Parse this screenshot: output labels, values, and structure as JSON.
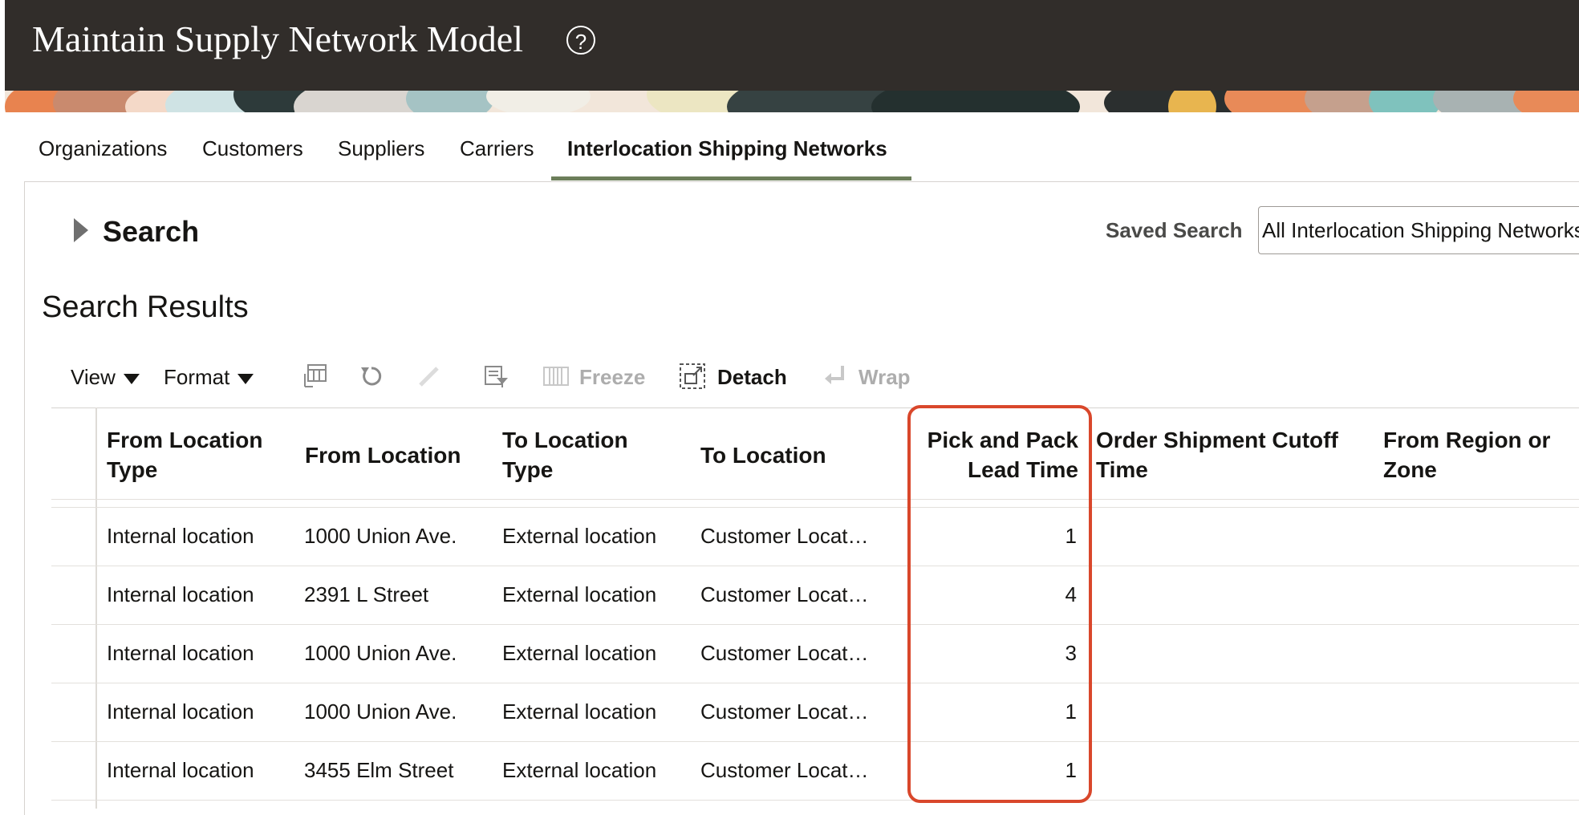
{
  "header": {
    "title": "Maintain Supply Network Model",
    "help_icon": "help-circle-icon"
  },
  "tabs": [
    {
      "label": "Organizations",
      "active": false
    },
    {
      "label": "Customers",
      "active": false
    },
    {
      "label": "Suppliers",
      "active": false
    },
    {
      "label": "Carriers",
      "active": false
    },
    {
      "label": "Interlocation Shipping Networks",
      "active": true
    }
  ],
  "search": {
    "title": "Search",
    "saved_search_label": "Saved Search",
    "saved_search_value": "All Interlocation Shipping Networks"
  },
  "results": {
    "title": "Search Results",
    "toolbar": {
      "view": "View",
      "format": "Format",
      "freeze": "Freeze",
      "detach": "Detach",
      "wrap": "Wrap"
    },
    "columns": {
      "from_type": [
        "From Location",
        "Type"
      ],
      "from_loc": "From Location",
      "to_type": [
        "To Location",
        "Type"
      ],
      "to_loc": "To Location",
      "pick_pack": [
        "Pick and Pack",
        "Lead Time"
      ],
      "cutoff": [
        "Order Shipment Cutoff",
        "Time"
      ],
      "region": [
        "From Region or",
        "Zone"
      ]
    },
    "rows": [
      {
        "from_type": "Internal location",
        "from_loc": "1000 Union Ave.",
        "to_type": "External location",
        "to_loc": "Customer Locat…",
        "pick_pack": "1"
      },
      {
        "from_type": "Internal location",
        "from_loc": "2391 L Street",
        "to_type": "External location",
        "to_loc": "Customer Locat…",
        "pick_pack": "4"
      },
      {
        "from_type": "Internal location",
        "from_loc": "1000 Union Ave.",
        "to_type": "External location",
        "to_loc": "Customer Locat…",
        "pick_pack": "3"
      },
      {
        "from_type": "Internal location",
        "from_loc": "1000 Union Ave.",
        "to_type": "External location",
        "to_loc": "Customer Locat…",
        "pick_pack": "1"
      },
      {
        "from_type": "Internal location",
        "from_loc": "3455 Elm Street",
        "to_type": "External location",
        "to_loc": "Customer Locat…",
        "pick_pack": "1"
      }
    ]
  },
  "colors": {
    "header_bg": "#312d2a",
    "tab_underline": "#6c7e5a",
    "highlight": "#d9472b"
  }
}
